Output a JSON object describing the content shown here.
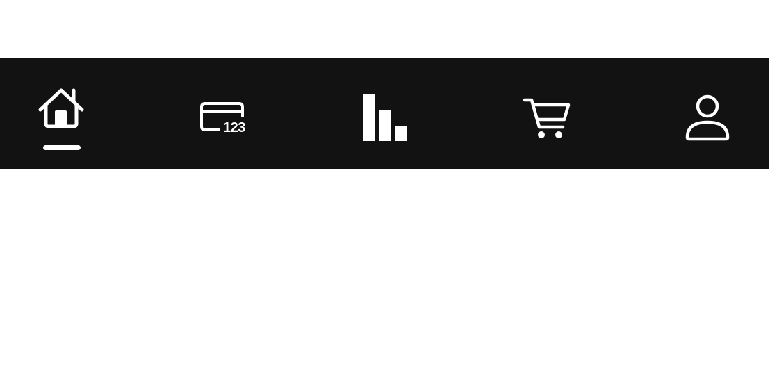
{
  "tab_bar": {
    "background": "#121212",
    "icon_color": "#ffffff",
    "active_tab": "home",
    "tabs": [
      {
        "id": "home",
        "icon": "home-icon",
        "active": true
      },
      {
        "id": "card",
        "icon": "credit-card-icon",
        "badge_text": "123",
        "active": false
      },
      {
        "id": "stats",
        "icon": "bar-chart-icon",
        "active": false
      },
      {
        "id": "cart",
        "icon": "shopping-cart-icon",
        "active": false
      },
      {
        "id": "profile",
        "icon": "user-icon",
        "active": false
      }
    ]
  }
}
